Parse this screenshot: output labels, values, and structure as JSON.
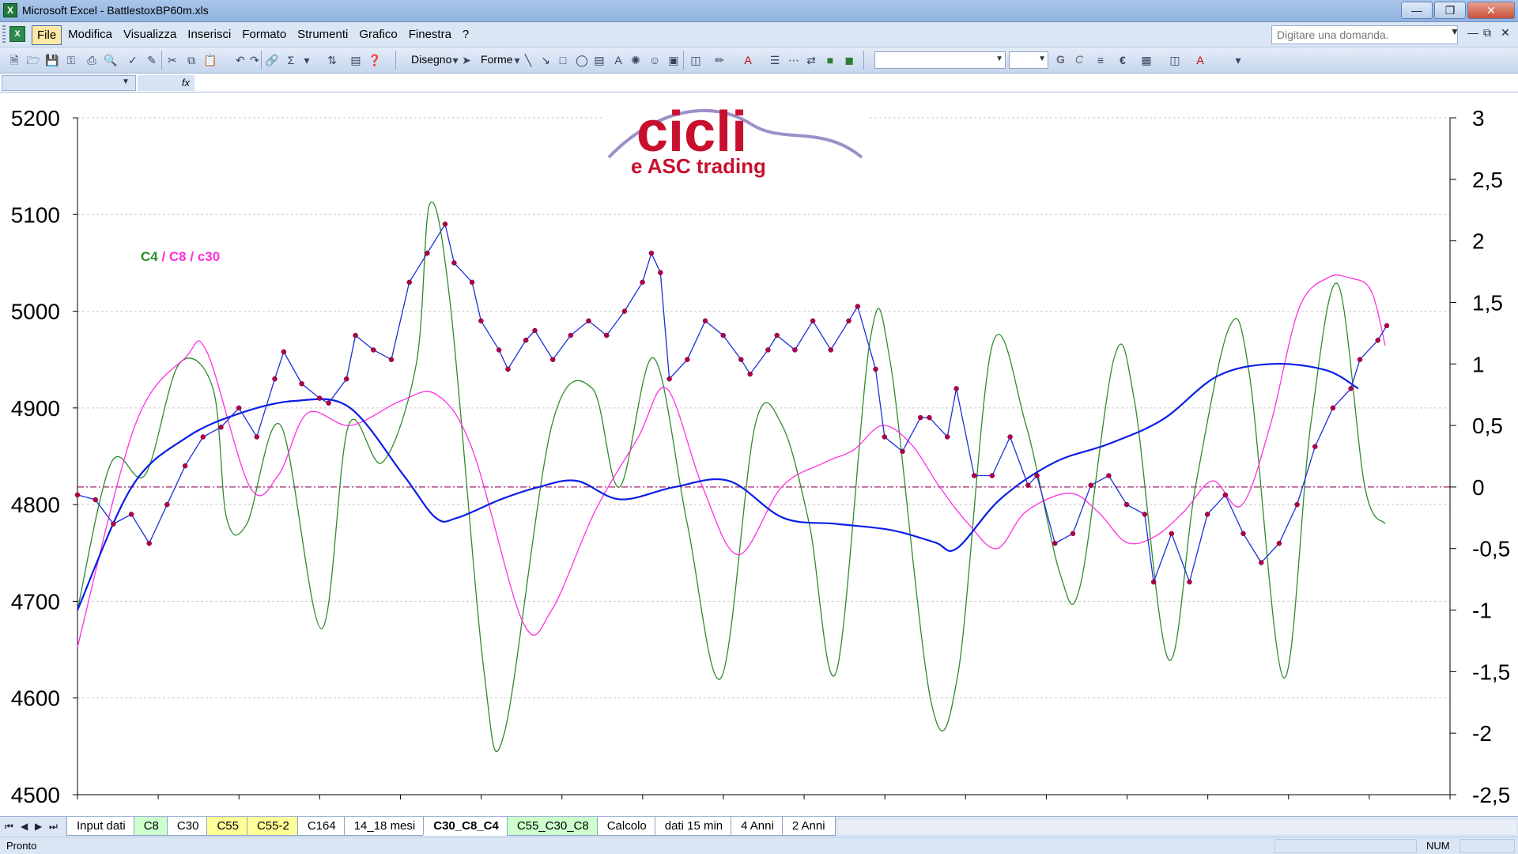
{
  "window": {
    "title": "Microsoft Excel - BattlestoxBP60m.xls",
    "buttons": [
      "minimize",
      "maximize",
      "close"
    ]
  },
  "menubar": {
    "items": [
      "File",
      "Modifica",
      "Visualizza",
      "Inserisci",
      "Formato",
      "Strumenti",
      "Grafico",
      "Finestra",
      "?"
    ],
    "ask_placeholder": "Digitare una domanda."
  },
  "toolbar": {
    "draw_label": "Disegno",
    "shapes_label": "Forme",
    "bold_label": "G",
    "italic_label": "C"
  },
  "sheet_tabs": [
    {
      "label": "Input dati",
      "color": "#ffffff"
    },
    {
      "label": "C8",
      "color": "#ccffcc"
    },
    {
      "label": "C30",
      "color": "#ffffff"
    },
    {
      "label": "C55",
      "color": "#ffff99"
    },
    {
      "label": "C55-2",
      "color": "#ffff99"
    },
    {
      "label": "C164",
      "color": "#ffffff"
    },
    {
      "label": "14_18 mesi",
      "color": "#ffffff"
    },
    {
      "label": "C30_C8_C4",
      "color": "#ffffff",
      "active": true
    },
    {
      "label": "C55_C30_C8",
      "color": "#ccffcc"
    },
    {
      "label": "Calcolo",
      "color": "#ffffff"
    },
    {
      "label": "dati 15 min",
      "color": "#ffffff"
    },
    {
      "label": "4 Anni",
      "color": "#ffffff"
    },
    {
      "label": "2 Anni",
      "color": "#ffffff"
    }
  ],
  "status": {
    "text": "Pronto",
    "num": "NUM"
  },
  "logo": {
    "main": "cicli",
    "sub": "e ASC trading"
  },
  "chart_data": {
    "type": "line",
    "annotation": {
      "c4": "C4",
      "sep": " / ",
      "c8c30": "C8 / c30"
    },
    "y_left": {
      "ylim": [
        4500,
        5200
      ],
      "ticks": [
        "5200",
        "5100",
        "5000",
        "4900",
        "4800",
        "4700",
        "4600",
        "4500"
      ]
    },
    "y_right": {
      "ylim": [
        -2.5,
        3
      ],
      "ticks": [
        "3",
        "2,5",
        "2",
        "1,5",
        "1",
        "0,5",
        "0",
        "-0,5",
        "-1",
        "-1,5",
        "-2",
        "-2,5"
      ]
    },
    "zero_line": 0,
    "x_count": 170,
    "series": [
      {
        "key": "price",
        "axis": "left",
        "color": "#1f2fd6",
        "marker_color": "#b0004a",
        "anchors": [
          [
            0,
            4810
          ],
          [
            4,
            4805
          ],
          [
            8,
            4780
          ],
          [
            12,
            4790
          ],
          [
            16,
            4760
          ],
          [
            20,
            4800
          ],
          [
            24,
            4840
          ],
          [
            28,
            4870
          ],
          [
            32,
            4880
          ],
          [
            36,
            4900
          ],
          [
            40,
            4870
          ],
          [
            44,
            4930
          ],
          [
            46,
            4958
          ],
          [
            50,
            4925
          ],
          [
            54,
            4910
          ],
          [
            56,
            4905
          ],
          [
            60,
            4930
          ],
          [
            62,
            4975
          ],
          [
            66,
            4960
          ],
          [
            70,
            4950
          ],
          [
            74,
            5030
          ],
          [
            78,
            5060
          ],
          [
            82,
            5090
          ],
          [
            84,
            5050
          ],
          [
            88,
            5030
          ],
          [
            90,
            4990
          ],
          [
            94,
            4960
          ],
          [
            96,
            4940
          ],
          [
            100,
            4970
          ],
          [
            102,
            4980
          ],
          [
            106,
            4950
          ],
          [
            110,
            4975
          ],
          [
            114,
            4990
          ],
          [
            118,
            4975
          ],
          [
            122,
            5000
          ],
          [
            126,
            5030
          ],
          [
            128,
            5060
          ],
          [
            130,
            5040
          ],
          [
            132,
            4930
          ],
          [
            136,
            4950
          ],
          [
            140,
            4990
          ],
          [
            144,
            4975
          ],
          [
            148,
            4950
          ],
          [
            150,
            4935
          ],
          [
            154,
            4960
          ],
          [
            156,
            4975
          ],
          [
            160,
            4960
          ],
          [
            164,
            4990
          ],
          [
            168,
            4960
          ],
          [
            172,
            4990
          ],
          [
            174,
            5005
          ],
          [
            178,
            4940
          ],
          [
            180,
            4870
          ],
          [
            184,
            4855
          ],
          [
            188,
            4890
          ],
          [
            190,
            4890
          ],
          [
            194,
            4870
          ],
          [
            196,
            4920
          ],
          [
            200,
            4830
          ],
          [
            204,
            4830
          ],
          [
            208,
            4870
          ],
          [
            212,
            4820
          ],
          [
            214,
            4830
          ],
          [
            218,
            4760
          ],
          [
            222,
            4770
          ],
          [
            226,
            4820
          ],
          [
            230,
            4830
          ],
          [
            234,
            4800
          ],
          [
            238,
            4790
          ],
          [
            240,
            4720
          ],
          [
            244,
            4770
          ],
          [
            248,
            4720
          ],
          [
            252,
            4790
          ],
          [
            256,
            4810
          ],
          [
            260,
            4770
          ],
          [
            264,
            4740
          ],
          [
            268,
            4760
          ],
          [
            272,
            4800
          ],
          [
            276,
            4860
          ],
          [
            280,
            4900
          ],
          [
            284,
            4920
          ],
          [
            286,
            4950
          ],
          [
            290,
            4970
          ],
          [
            292,
            4985
          ]
        ]
      },
      {
        "key": "c4",
        "axis": "right",
        "color": "#2e8b2e",
        "anchors": [
          [
            0,
            -1
          ],
          [
            5,
            0.2
          ],
          [
            10,
            0.1
          ],
          [
            15,
            1.0
          ],
          [
            20,
            0.8
          ],
          [
            22,
            -0.25
          ],
          [
            25,
            -0.3
          ],
          [
            30,
            0.5
          ],
          [
            36,
            -1.15
          ],
          [
            40,
            0.5
          ],
          [
            45,
            0.2
          ],
          [
            50,
            1.0
          ],
          [
            52,
            2.3
          ],
          [
            55,
            1.5
          ],
          [
            60,
            -1.5
          ],
          [
            63,
            -2.0
          ],
          [
            70,
            0.5
          ],
          [
            76,
            0.8
          ],
          [
            80,
            0.0
          ],
          [
            85,
            1.05
          ],
          [
            90,
            -0.3
          ],
          [
            95,
            -1.55
          ],
          [
            100,
            0.5
          ],
          [
            104,
            0.5
          ],
          [
            108,
            -0.3
          ],
          [
            112,
            -1.5
          ],
          [
            117,
            1.2
          ],
          [
            120,
            1.0
          ],
          [
            126,
            -1.75
          ],
          [
            130,
            -1.5
          ],
          [
            135,
            1.15
          ],
          [
            140,
            0.5
          ],
          [
            145,
            -0.7
          ],
          [
            148,
            -0.8
          ],
          [
            153,
            1.05
          ],
          [
            156,
            0.7
          ],
          [
            161,
            -1.4
          ],
          [
            165,
            0.0
          ],
          [
            170,
            1.3
          ],
          [
            173,
            0.9
          ],
          [
            178,
            -1.55
          ],
          [
            182,
            0.5
          ],
          [
            186,
            1.65
          ],
          [
            190,
            0.0
          ],
          [
            193,
            -0.3
          ]
        ]
      },
      {
        "key": "c8",
        "axis": "right",
        "color": "#ff30e0",
        "anchors": [
          [
            0,
            -1.3
          ],
          [
            8,
            0.5
          ],
          [
            15,
            1.05
          ],
          [
            18,
            1.1
          ],
          [
            24,
            0.0
          ],
          [
            28,
            0.1
          ],
          [
            32,
            0.6
          ],
          [
            38,
            0.5
          ],
          [
            45,
            0.7
          ],
          [
            50,
            0.75
          ],
          [
            55,
            0.3
          ],
          [
            62,
            -1.1
          ],
          [
            66,
            -1.0
          ],
          [
            72,
            -0.2
          ],
          [
            78,
            0.4
          ],
          [
            82,
            0.8
          ],
          [
            87,
            0.0
          ],
          [
            92,
            -0.55
          ],
          [
            98,
            0.0
          ],
          [
            104,
            0.2
          ],
          [
            108,
            0.3
          ],
          [
            112,
            0.5
          ],
          [
            116,
            0.35
          ],
          [
            120,
            0.0
          ],
          [
            124,
            -0.3
          ],
          [
            128,
            -0.5
          ],
          [
            132,
            -0.2
          ],
          [
            138,
            -0.05
          ],
          [
            142,
            -0.2
          ],
          [
            146,
            -0.45
          ],
          [
            150,
            -0.4
          ],
          [
            154,
            -0.2
          ],
          [
            158,
            0.05
          ],
          [
            162,
            -0.15
          ],
          [
            166,
            0.5
          ],
          [
            170,
            1.45
          ],
          [
            174,
            1.7
          ],
          [
            177,
            1.7
          ],
          [
            180,
            1.6
          ],
          [
            182,
            1.15
          ]
        ]
      },
      {
        "key": "c30",
        "axis": "right",
        "color": "#0a1ee6",
        "anchors": [
          [
            0,
            -1.0
          ],
          [
            10,
            0.0
          ],
          [
            20,
            0.4
          ],
          [
            30,
            0.6
          ],
          [
            40,
            0.7
          ],
          [
            50,
            0.65
          ],
          [
            60,
            0.1
          ],
          [
            66,
            -0.25
          ],
          [
            70,
            -0.25
          ],
          [
            78,
            -0.1
          ],
          [
            85,
            0.0
          ],
          [
            92,
            0.05
          ],
          [
            100,
            -0.1
          ],
          [
            110,
            0.0
          ],
          [
            120,
            0.05
          ],
          [
            130,
            -0.25
          ],
          [
            140,
            -0.3
          ],
          [
            150,
            -0.35
          ],
          [
            158,
            -0.45
          ],
          [
            162,
            -0.5
          ],
          [
            170,
            -0.1
          ],
          [
            180,
            0.2
          ],
          [
            190,
            0.35
          ],
          [
            200,
            0.55
          ],
          [
            210,
            0.9
          ],
          [
            220,
            1.0
          ],
          [
            230,
            0.95
          ],
          [
            236,
            0.8
          ]
        ]
      }
    ]
  }
}
